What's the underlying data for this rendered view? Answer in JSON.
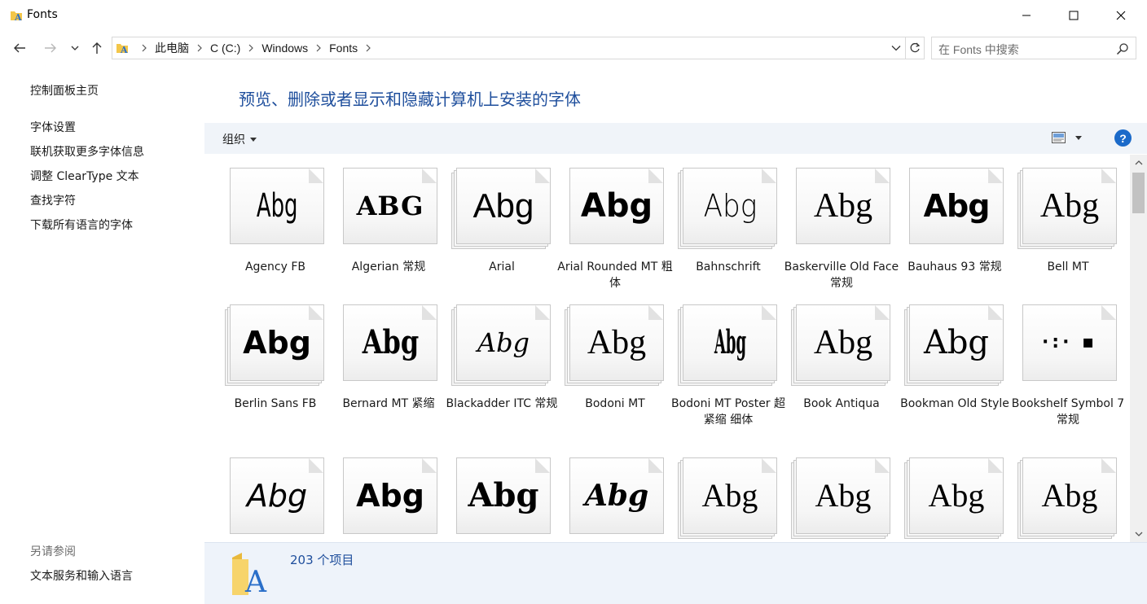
{
  "window": {
    "title": "Fonts",
    "minimize_icon": "minimize-icon",
    "maximize_icon": "maximize-icon",
    "close_icon": "close-icon"
  },
  "nav": {
    "breadcrumbs": [
      "此电脑",
      "C (C:)",
      "Windows",
      "Fonts"
    ],
    "search_placeholder": "在 Fonts 中搜索"
  },
  "sidebar": {
    "control_panel_home": "控制面板主页",
    "tasks": [
      "字体设置",
      "联机获取更多字体信息",
      "调整 ClearType 文本",
      "查找字符",
      "下载所有语言的字体"
    ],
    "see_also_heading": "另请参阅",
    "see_also": [
      "文本服务和输入语言"
    ]
  },
  "main": {
    "heading": "预览、删除或者显示和隐藏计算机上安装的字体",
    "organize_label": "组织",
    "help_label": "?"
  },
  "fonts": [
    {
      "name": "Agency FB",
      "sample": "Abg"
    },
    {
      "name": "Algerian 常规",
      "sample": "ABG"
    },
    {
      "name": "Arial",
      "sample": "Abg"
    },
    {
      "name": "Arial Rounded MT 粗体",
      "sample": "Abg"
    },
    {
      "name": "Bahnschrift",
      "sample": "Abg"
    },
    {
      "name": "Baskerville Old Face 常规",
      "sample": "Abg"
    },
    {
      "name": "Bauhaus 93 常规",
      "sample": "Abg"
    },
    {
      "name": "Bell MT",
      "sample": "Abg"
    },
    {
      "name": "Berlin Sans FB",
      "sample": "Abg"
    },
    {
      "name": "Bernard MT 紧缩",
      "sample": "Abg"
    },
    {
      "name": "Blackadder ITC 常规",
      "sample": "Abg"
    },
    {
      "name": "Bodoni MT",
      "sample": "Abg"
    },
    {
      "name": "Bodoni MT Poster 超紧缩 细体",
      "sample": "Abg"
    },
    {
      "name": "Book Antiqua",
      "sample": "Abg"
    },
    {
      "name": "Bookman Old Style",
      "sample": "Abg"
    },
    {
      "name": "Bookshelf Symbol 7 常规",
      "sample": "·:·  ▪"
    },
    {
      "name": "",
      "sample": "Abg"
    },
    {
      "name": "",
      "sample": "Abg"
    },
    {
      "name": "",
      "sample": "Abg"
    },
    {
      "name": "",
      "sample": "Abg"
    },
    {
      "name": "",
      "sample": "Abg"
    },
    {
      "name": "",
      "sample": "Abg"
    },
    {
      "name": "",
      "sample": "Abg"
    },
    {
      "name": "",
      "sample": "Abg"
    }
  ],
  "details": {
    "count": "203 个项目"
  }
}
